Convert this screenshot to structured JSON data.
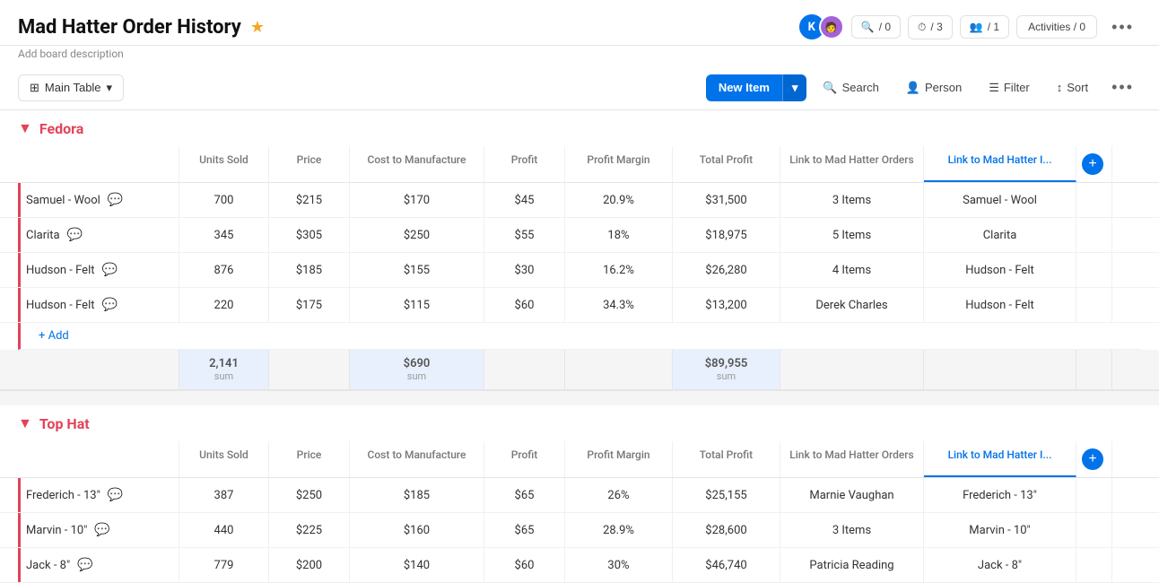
{
  "header": {
    "title": "Mad Hatter Order History",
    "subtitle": "Add board description",
    "star": "★",
    "avatarK": "K",
    "avatarOverlay": "",
    "search_count": "/ 0",
    "automation_count": "/ 3",
    "invite_count": "/ 1",
    "activities_label": "Activities / 0",
    "more_icon": "•••"
  },
  "toolbar": {
    "view_icon": "⊞",
    "view_label": "Main Table",
    "view_chevron": "▾",
    "new_item_label": "New Item",
    "new_item_arrow": "▾",
    "search_label": "Search",
    "person_label": "Person",
    "filter_label": "Filter",
    "sort_label": "Sort",
    "more_icon": "•••"
  },
  "groups": [
    {
      "id": "fedora",
      "name": "Fedora",
      "color": "#e44258",
      "columns": [
        "",
        "Units Sold",
        "Price",
        "Cost to Manufacture",
        "Profit",
        "Profit Margin",
        "Total Profit",
        "Link to Mad Hatter Orders",
        "Link to Mad Hatter I..."
      ],
      "rows": [
        {
          "name": "Samuel - Wool",
          "units": "700",
          "price": "$215",
          "cost": "$170",
          "profit": "$45",
          "margin": "20.9%",
          "total_profit": "$31,500",
          "link_orders": "3 Items",
          "link_hatter": "Samuel - Wool"
        },
        {
          "name": "Clarita",
          "units": "345",
          "price": "$305",
          "cost": "$250",
          "profit": "$55",
          "margin": "18%",
          "total_profit": "$18,975",
          "link_orders": "5 Items",
          "link_hatter": "Clarita"
        },
        {
          "name": "Hudson - Felt",
          "units": "876",
          "price": "$185",
          "cost": "$155",
          "profit": "$30",
          "margin": "16.2%",
          "total_profit": "$26,280",
          "link_orders": "4 Items",
          "link_hatter": "Hudson - Felt"
        },
        {
          "name": "Hudson - Felt",
          "units": "220",
          "price": "$175",
          "cost": "$115",
          "profit": "$60",
          "margin": "34.3%",
          "total_profit": "$13,200",
          "link_orders": "Derek Charles",
          "link_hatter": "Hudson - Felt"
        }
      ],
      "add_label": "+ Add",
      "summary": {
        "units": "2,141",
        "units_label": "sum",
        "cost": "$690",
        "cost_label": "sum",
        "total_profit": "$89,955",
        "total_profit_label": "sum"
      }
    },
    {
      "id": "tophat",
      "name": "Top Hat",
      "color": "#e44258",
      "columns": [
        "",
        "Units Sold",
        "Price",
        "Cost to Manufacture",
        "Profit",
        "Profit Margin",
        "Total Profit",
        "Link to Mad Hatter Orders",
        "Link to Mad Hatter I..."
      ],
      "rows": [
        {
          "name": "Frederich - 13\"",
          "units": "387",
          "price": "$250",
          "cost": "$185",
          "profit": "$65",
          "margin": "26%",
          "total_profit": "$25,155",
          "link_orders": "Marnie Vaughan",
          "link_hatter": "Frederich - 13\""
        },
        {
          "name": "Marvin - 10\"",
          "units": "440",
          "price": "$225",
          "cost": "$160",
          "profit": "$65",
          "margin": "28.9%",
          "total_profit": "$28,600",
          "link_orders": "3 Items",
          "link_hatter": "Marvin - 10\""
        },
        {
          "name": "Jack - 8\"",
          "units": "779",
          "price": "$200",
          "cost": "$140",
          "profit": "$60",
          "margin": "30%",
          "total_profit": "$46,740",
          "link_orders": "Patricia Reading",
          "link_hatter": "Jack - 8\""
        }
      ],
      "add_label": "+ Add",
      "summary": {}
    }
  ]
}
